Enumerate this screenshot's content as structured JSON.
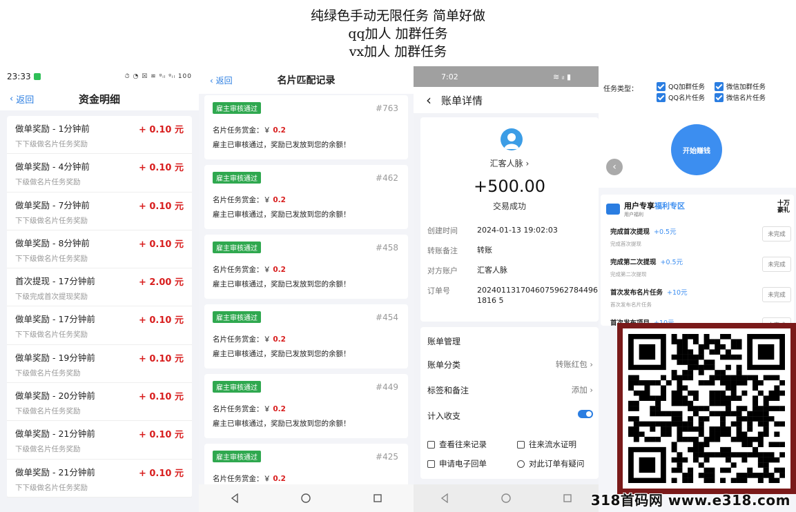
{
  "header": {
    "line1": "纯绿色手动无限任务 简单好做",
    "line2": "qq加人 加群任务",
    "line3": "vx加人 加群任务"
  },
  "p1": {
    "time": "23:33",
    "status_icons": "⏱ ◔ ☒ ≋ ᵍᵢₗ ᵍᵢₗ 100",
    "back": "返回",
    "title": "资金明细",
    "rows": [
      {
        "title": "做单奖励 - 1分钟前",
        "sub": "下下级做名片任务奖励",
        "amount": "+ 0.10 元"
      },
      {
        "title": "做单奖励 - 4分钟前",
        "sub": "下级做名片任务奖励",
        "amount": "+ 0.10 元"
      },
      {
        "title": "做单奖励 - 7分钟前",
        "sub": "下下级做名片任务奖励",
        "amount": "+ 0.10 元"
      },
      {
        "title": "做单奖励 - 8分钟前",
        "sub": "下下级做名片任务奖励",
        "amount": "+ 0.10 元"
      },
      {
        "title": "首次提现 - 17分钟前",
        "sub": "下级完成首次提现奖励",
        "amount": "+ 2.00 元"
      },
      {
        "title": "做单奖励 - 17分钟前",
        "sub": "下下级做名片任务奖励",
        "amount": "+ 0.10 元"
      },
      {
        "title": "做单奖励 - 19分钟前",
        "sub": "下级做名片任务奖励",
        "amount": "+ 0.10 元"
      },
      {
        "title": "做单奖励 - 20分钟前",
        "sub": "下级做名片任务奖励",
        "amount": "+ 0.10 元"
      },
      {
        "title": "做单奖励 - 21分钟前",
        "sub": "下级做名片任务奖励",
        "amount": "+ 0.10 元"
      },
      {
        "title": "做单奖励 - 21分钟前",
        "sub": "下下级做名片任务奖励",
        "amount": "+ 0.10 元"
      }
    ]
  },
  "p2": {
    "back": "返回",
    "title": "名片匹配记录",
    "cards": [
      {
        "badge": "雇主审核通过",
        "num": "#763",
        "label": "名片任务赏金：￥",
        "reward": "0.2",
        "msg": "雇主已审核通过，奖励已发放到您的余额！"
      },
      {
        "badge": "雇主审核通过",
        "num": "#462",
        "label": "名片任务赏金：￥",
        "reward": "0.2",
        "msg": "雇主已审核通过，奖励已发放到您的余额！"
      },
      {
        "badge": "雇主审核通过",
        "num": "#458",
        "label": "名片任务赏金：￥",
        "reward": "0.2",
        "msg": "雇主已审核通过，奖励已发放到您的余额！"
      },
      {
        "badge": "雇主审核通过",
        "num": "#454",
        "label": "名片任务赏金：￥",
        "reward": "0.2",
        "msg": "雇主已审核通过，奖励已发放到您的余额！"
      },
      {
        "badge": "雇主审核通过",
        "num": "#449",
        "label": "名片任务赏金：￥",
        "reward": "0.2",
        "msg": "雇主已审核通过，奖励已发放到您的余额！"
      },
      {
        "badge": "雇主审核通过",
        "num": "#425",
        "label": "名片任务赏金：￥",
        "reward": "0.2",
        "msg": ""
      }
    ]
  },
  "p3": {
    "time": "7:02",
    "status_icons": "≋ ᵢₗ ▮",
    "title": "账单详情",
    "merchant": "汇客人脉",
    "amount": "+500.00",
    "status": "交易成功",
    "fields": [
      {
        "k": "创建时间",
        "v": "2024-01-13 19:02:03"
      },
      {
        "k": "转账备注",
        "v": "转账"
      },
      {
        "k": "对方账户",
        "v": "汇客人脉"
      },
      {
        "k": "订单号",
        "v": "20240113170460759627844961816 5"
      }
    ],
    "mgmt_title": "账单管理",
    "category_label": "账单分类",
    "category_value": "转账红包",
    "tags_label": "标签和备注",
    "tags_value": "添加",
    "income_label": "计入收支",
    "links": [
      "查看往来记录",
      "往来流水证明",
      "申请电子回单",
      "对此订单有疑问"
    ]
  },
  "p4": {
    "task_type_label": "任务类型：",
    "options": [
      "QQ加群任务",
      "微信加群任务",
      "QQ名片任务",
      "微信名片任务"
    ],
    "start_button": "开始赚钱",
    "zone_title_a": "用户专享",
    "zone_title_b": "福利专区",
    "zone_sub": "用户福利",
    "gift_a": "十万",
    "gift_b": "豪礼",
    "tasks": [
      {
        "name": "完成首次提现",
        "reward": "+0.5元",
        "sub": "完成首次提现",
        "btn": "未完成"
      },
      {
        "name": "完成第二次提现",
        "reward": "+0.5元",
        "sub": "完成第二次提现",
        "btn": "未完成"
      },
      {
        "name": "首次发布名片任务",
        "reward": "+10元",
        "sub": "首次发布名片任务",
        "btn": "未完成"
      },
      {
        "name": "首次发布项目",
        "reward": "+10元",
        "sub": "",
        "btn": "未完成"
      }
    ]
  },
  "watermark": "318首码网 www.e318.com",
  "colors": {
    "accent": "#2a7de1",
    "red": "#d81e1e",
    "green": "#2fa84f",
    "start_blue": "#3c8ef0"
  }
}
